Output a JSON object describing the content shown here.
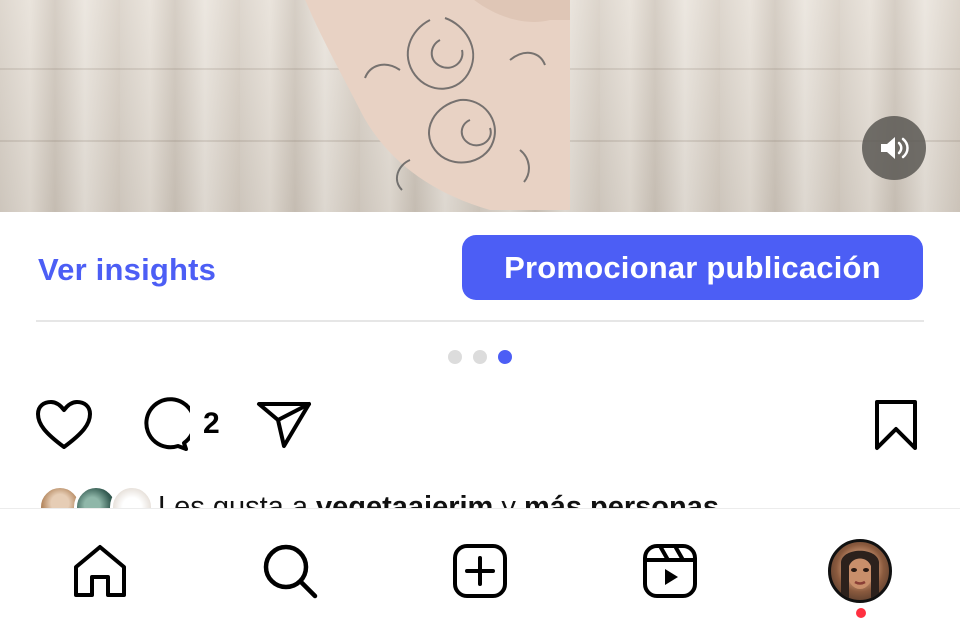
{
  "media": {
    "sound_icon": "speaker-icon"
  },
  "actions": {
    "insights_label": "Ver insights",
    "promote_label": "Promocionar publicación"
  },
  "carousel": {
    "total": 3,
    "active_index": 2
  },
  "post": {
    "comment_count": "2",
    "icons": [
      "heart-icon",
      "comment-icon",
      "share-icon",
      "bookmark-icon"
    ]
  },
  "likes": {
    "prefix": "Les gusta a ",
    "user": "vegetaaierim",
    "connector": " y ",
    "others": "más personas"
  },
  "nav": {
    "items": [
      "home-icon",
      "search-icon",
      "create-icon",
      "reels-icon",
      "profile-avatar"
    ]
  },
  "colors": {
    "accent": "#4c5ef5",
    "notification": "#ff3040"
  }
}
